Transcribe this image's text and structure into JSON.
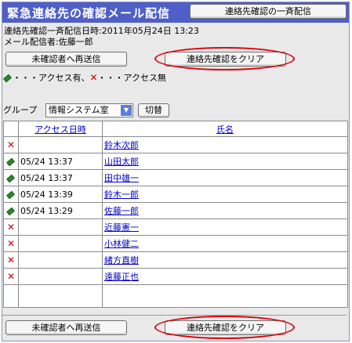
{
  "header": {
    "title": "緊急連絡先の確認メール配信",
    "broadcast_button": "連絡先確認の一斉配信"
  },
  "info": {
    "sent_line": "連絡先確認一斉配信日時:2011年05月24日 13:23",
    "sender_line": "メール配信者:佐藤一郎"
  },
  "actions": {
    "resend_label": "未確認者へ再送信",
    "clear_label": "連絡先確認をクリア"
  },
  "legend": {
    "accessed": "・・・アクセス有、",
    "not_accessed": "・・・アクセス無"
  },
  "filter": {
    "label": "グループ",
    "selected": "情報システム室",
    "switch_label": "切替"
  },
  "table": {
    "columns": [
      "アクセス日時",
      "氏名"
    ],
    "rows": [
      {
        "status": "x",
        "time": "",
        "name": "鈴木次郎"
      },
      {
        "status": "pen",
        "time": "05/24 13:37",
        "name": "山田太郎"
      },
      {
        "status": "pen",
        "time": "05/24 13:37",
        "name": "田中雄一"
      },
      {
        "status": "pen",
        "time": "05/24 13:39",
        "name": "鈴木一郎"
      },
      {
        "status": "pen",
        "time": "05/24 13:29",
        "name": "佐藤一郎"
      },
      {
        "status": "x",
        "time": "",
        "name": "近藤憲一"
      },
      {
        "status": "x",
        "time": "",
        "name": "小林健二"
      },
      {
        "status": "x",
        "time": "",
        "name": "緒方直樹"
      },
      {
        "status": "x",
        "time": "",
        "name": "遠藤正也"
      }
    ]
  },
  "colors": {
    "titlebar": "#4f5fc8",
    "highlight": "#e0000c",
    "accessed_icon": "#2a8b2a",
    "not_accessed_icon": "#d40000",
    "link": "#0000cc"
  }
}
